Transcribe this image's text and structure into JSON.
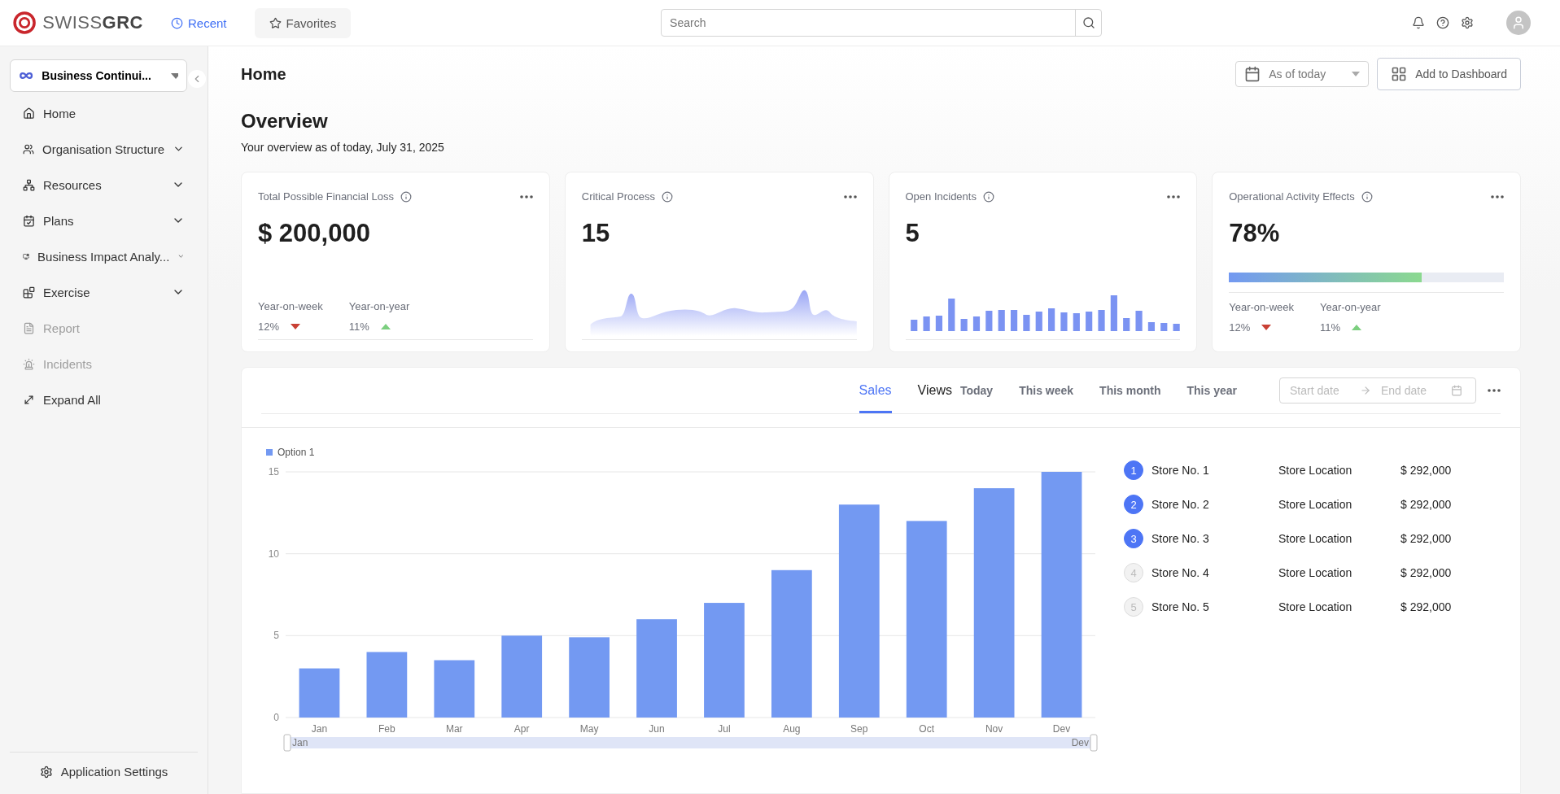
{
  "topbar": {
    "logo": "SWISS**GRC**",
    "nav": [
      {
        "label": "Recent",
        "selected": true
      },
      {
        "label": "Favorites",
        "selected": false
      }
    ],
    "search": {
      "placeholder": "Search"
    }
  },
  "sidebar": {
    "workspace": "Business Continui...",
    "items": [
      {
        "label": "Home",
        "expandable": false,
        "disabled": false
      },
      {
        "label": "Organisation Structure",
        "expandable": true,
        "disabled": false
      },
      {
        "label": "Resources",
        "expandable": true,
        "disabled": false
      },
      {
        "label": "Plans",
        "expandable": true,
        "disabled": false
      },
      {
        "label": "Business Impact Analy...",
        "expandable": true,
        "disabled": false
      },
      {
        "label": "Exercise",
        "expandable": true,
        "disabled": false
      },
      {
        "label": "Report",
        "expandable": false,
        "disabled": true
      },
      {
        "label": "Incidents",
        "expandable": false,
        "disabled": true
      },
      {
        "label": "Expand All",
        "expandable": false,
        "disabled": false
      }
    ],
    "footer": "Application Settings"
  },
  "page": {
    "title": "Home",
    "date_select": "As of today",
    "add_button": "Add to Dashboard",
    "heading": "Overview",
    "subtitle": "Your overview as of today, July 31, 2025"
  },
  "cards": [
    {
      "kind": "trend",
      "title": "Total Possible Financial Loss",
      "value": "$ 200,000",
      "trends": [
        {
          "label": "Year-on-week",
          "value": "12%",
          "rising": false
        },
        {
          "label": "Year-on-year",
          "value": "11%",
          "rising": true
        }
      ]
    },
    {
      "kind": "area",
      "title": "Critical Process",
      "value": "15"
    },
    {
      "kind": "bars",
      "title": "Open Incidents",
      "value": "5"
    },
    {
      "kind": "progress",
      "title": "Operational Activity Effects",
      "value": "78%",
      "level": 0.7,
      "trends": [
        {
          "label": "Year-on-week",
          "value": "12%",
          "rising": false
        },
        {
          "label": "Year-on-year",
          "value": "11%",
          "rising": true
        }
      ]
    }
  ],
  "sales": {
    "tabs": [
      {
        "label": "Sales",
        "selected": true
      },
      {
        "label": "Views",
        "selected": false
      }
    ],
    "periods": [
      "Today",
      "This week",
      "This month",
      "This year"
    ],
    "range": {
      "start_placeholder": "Start date",
      "end_placeholder": "End date"
    },
    "chart_data": {
      "type": "bar",
      "categories": [
        "Jan",
        "Feb",
        "Mar",
        "Apr",
        "May",
        "Jun",
        "Jul",
        "Aug",
        "Sep",
        "Oct",
        "Nov",
        "Dev"
      ],
      "series": [
        {
          "name": "Option 1",
          "color": "#7399f2",
          "values": [
            3,
            4,
            3.5,
            5,
            4.9,
            6,
            7,
            9,
            13,
            12,
            14,
            15
          ]
        }
      ],
      "ylim": [
        0,
        15
      ],
      "yticks": [
        0,
        5,
        10,
        15
      ]
    },
    "zoom_labels": [
      "Jan",
      "Dev"
    ],
    "stores": [
      {
        "rank": "1",
        "name": "Store No. 1",
        "location": "Store Location",
        "amount": "$ 292,000",
        "highlighted": true
      },
      {
        "rank": "2",
        "name": "Store No. 2",
        "location": "Store Location",
        "amount": "$ 292,000",
        "highlighted": true
      },
      {
        "rank": "3",
        "name": "Store No. 3",
        "location": "Store Location",
        "amount": "$ 292,000",
        "highlighted": true
      },
      {
        "rank": "4",
        "name": "Store No. 4",
        "location": "Store Location",
        "amount": "$ 292,000",
        "highlighted": false
      },
      {
        "rank": "5",
        "name": "Store No. 5",
        "location": "Store Location",
        "amount": "$ 292,000",
        "highlighted": false
      }
    ]
  }
}
